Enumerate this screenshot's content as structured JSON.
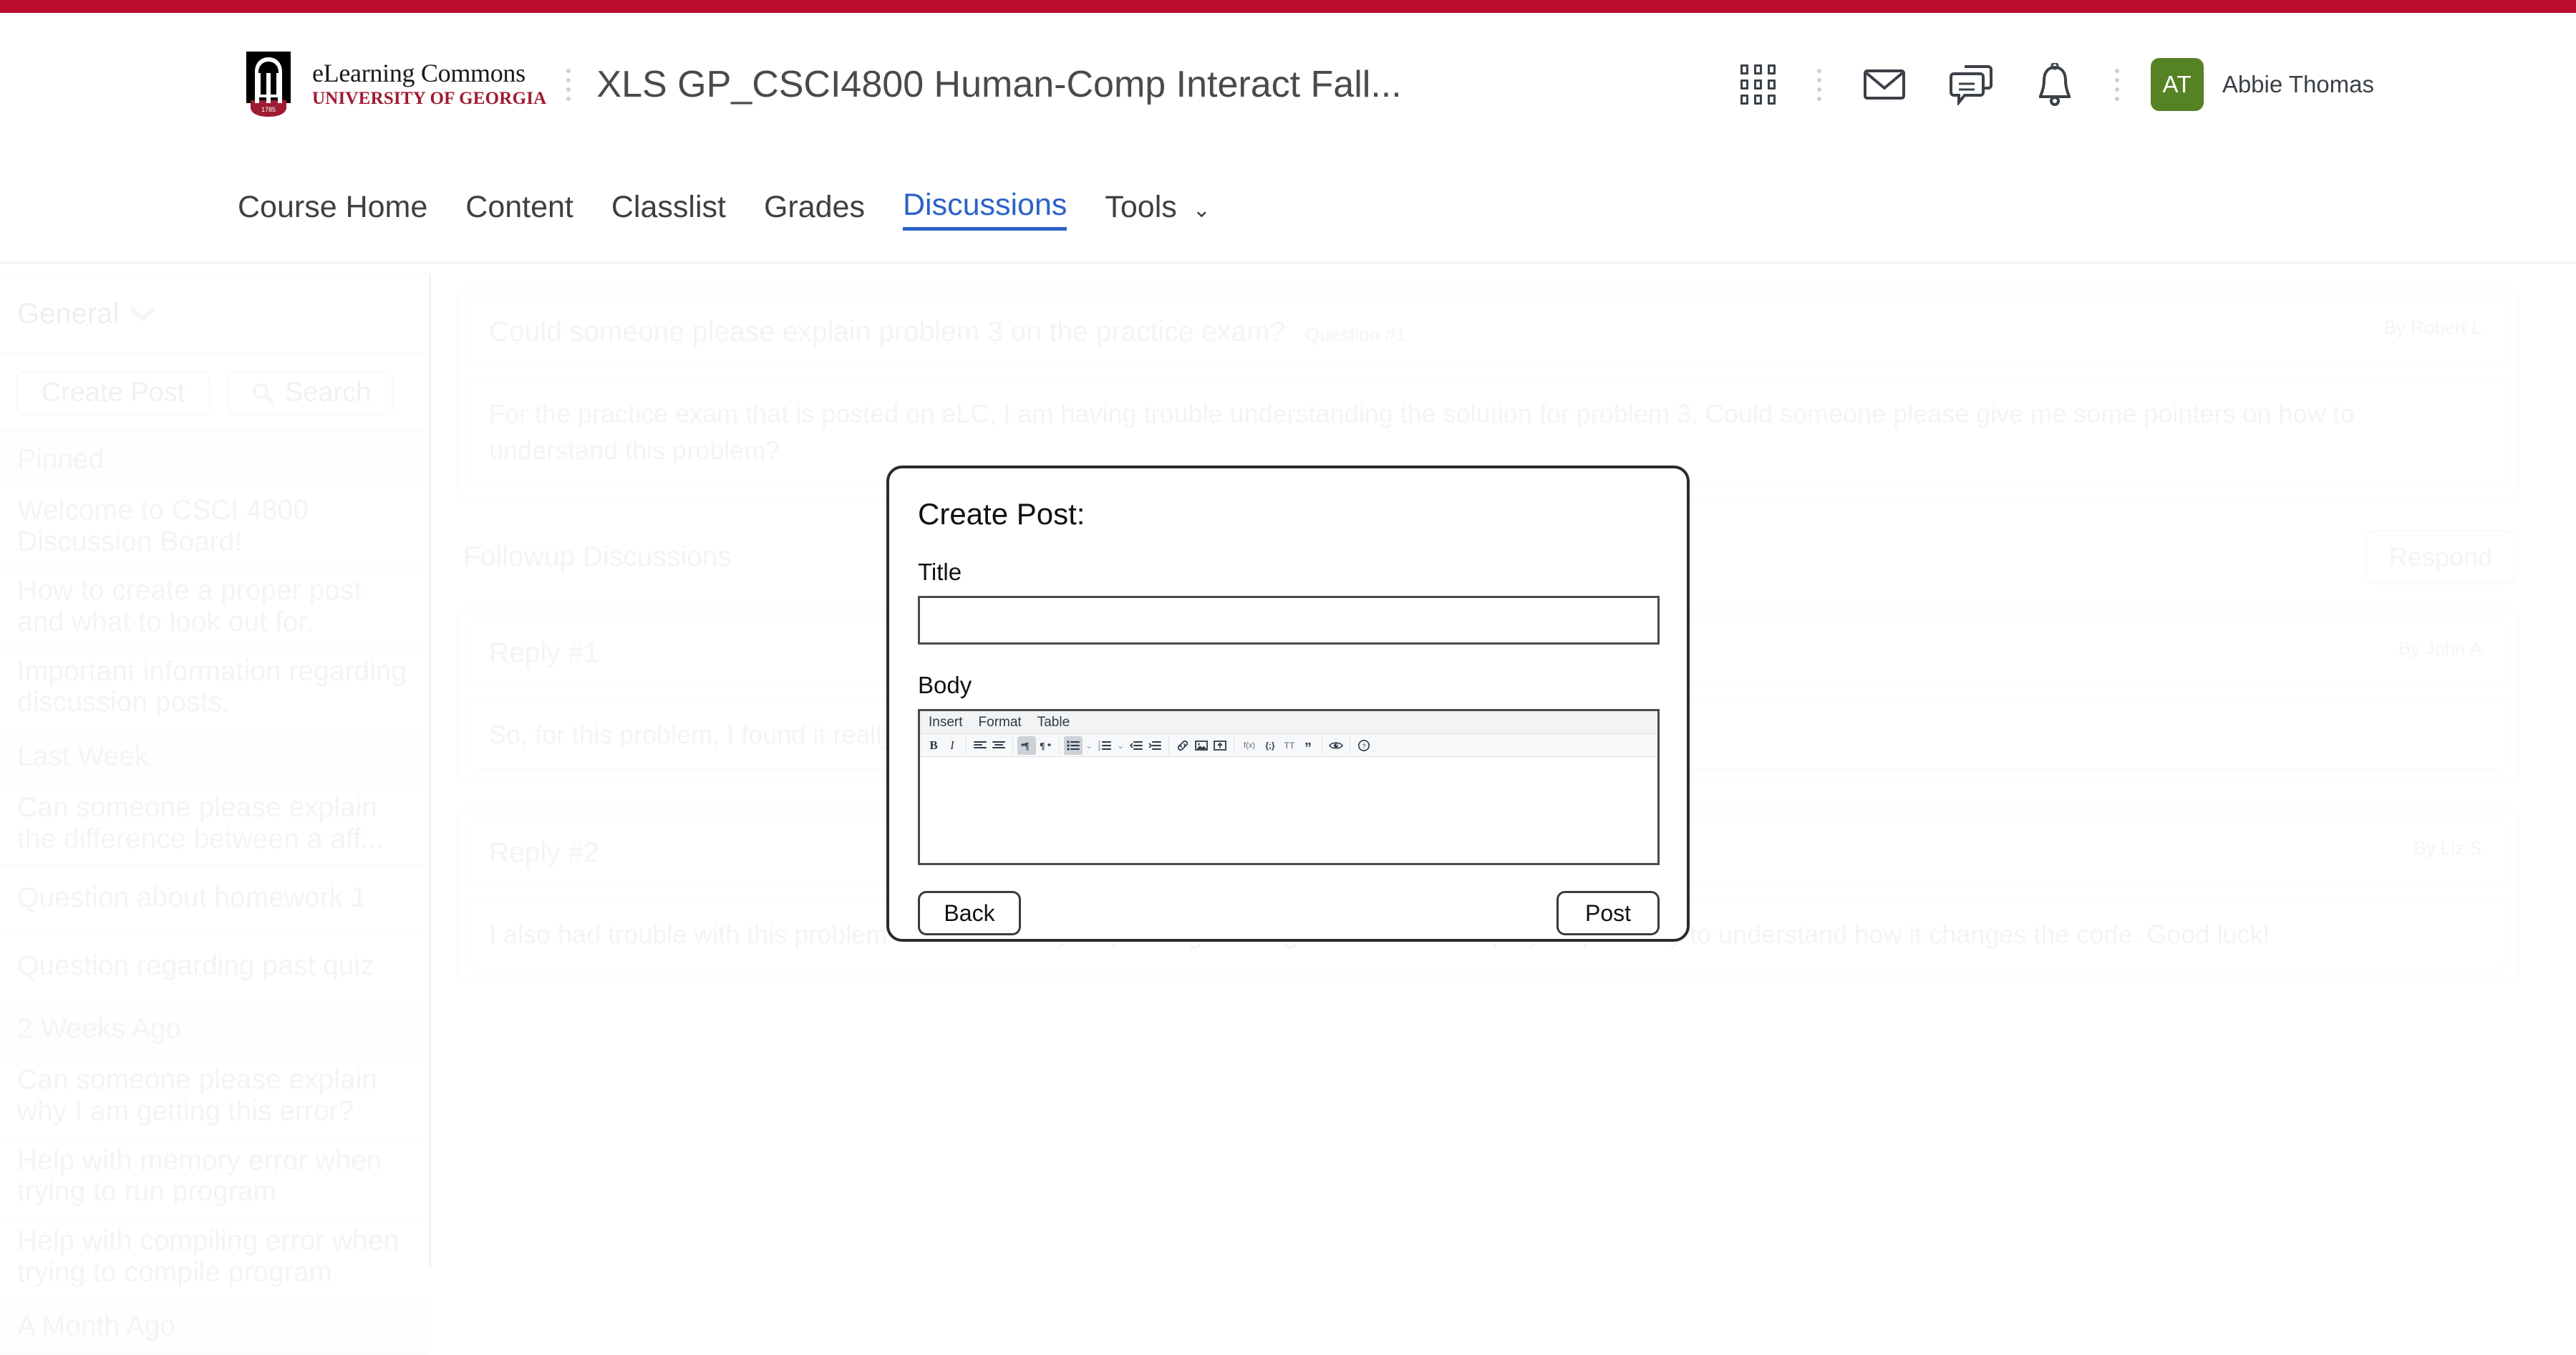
{
  "theme": {
    "crimson": "#BA0C2F",
    "brand_red": "#9E1B32",
    "avatar_green": "#558223",
    "active_blue": "#2B62C8"
  },
  "header": {
    "logo_line1": "eLearning Commons",
    "logo_line2": "UNIVERSITY OF GEORGIA",
    "logo_year": "1785",
    "course_title": "XLS GP_CSCI4800 Human-Comp Interact Fall...",
    "icons": [
      "waffle-icon",
      "email-icon",
      "chat-icon",
      "bell-icon"
    ],
    "avatar_initials": "AT",
    "user_name": "Abbie Thomas"
  },
  "nav": {
    "items": [
      {
        "label": "Course Home",
        "active": false,
        "caret": ""
      },
      {
        "label": "Content",
        "active": false,
        "caret": ""
      },
      {
        "label": "Classlist",
        "active": false,
        "caret": ""
      },
      {
        "label": "Grades",
        "active": false,
        "caret": ""
      },
      {
        "label": "Discussions",
        "active": true,
        "caret": ""
      },
      {
        "label": "Tools",
        "active": false,
        "caret": "⌄"
      }
    ]
  },
  "sidebar": {
    "forum_label": "General",
    "forum_caret": "❯",
    "create_post_label": "Create Post",
    "search_label": "Search",
    "search_icon": "search-icon",
    "groups": [
      {
        "label": "Pinned",
        "items": [
          "Welcome to CSCI 4800 Discussion Board!",
          "How to create a proper post and what to look out for.",
          "Important information regarding discussion posts."
        ]
      },
      {
        "label": "Last Week",
        "items": [
          "Can someone please explain the difference between a aff...",
          "Question about homework 1",
          "Question regarding past quiz"
        ]
      },
      {
        "label": "2 Weeks Ago",
        "items": [
          "Can someone please explain why I am getting this error?",
          "Help with memory error when trying to run program",
          "Help with compiling error when trying to compile program"
        ]
      },
      {
        "label": "A Month Ago",
        "items": []
      }
    ]
  },
  "thread": {
    "question": {
      "title": "Could someone please explain problem 3 on the practice exam?",
      "tag": "Question #1",
      "author": "By Robert L.",
      "body": "For the practice exam that is posted on eLC, I am having trouble understanding the solution for problem 3. Could someone please give me some pointers on how to understand this problem?"
    },
    "followup_label": "Followup Discussions",
    "respond_label": "Respond",
    "replies": [
      {
        "title": "Reply #1",
        "author": "By John A.",
        "body": "So, for this problem, I found it really helpful to look at this topic. Hope this helps!"
      },
      {
        "title": "Reply #2",
        "author": "By Liz S.",
        "body": "I also had trouble with this problem. I found it really helpful to go through the solution step by step and try to understand how it changes the code. Good luck!"
      }
    ]
  },
  "modal": {
    "heading": "Create Post:",
    "title_label": "Title",
    "title_value": "",
    "body_label": "Body",
    "editor": {
      "menus": [
        "Insert",
        "Format",
        "Table"
      ],
      "toolbar": [
        {
          "name": "bold-icon",
          "glyph": "B",
          "active": false
        },
        {
          "name": "italic-icon",
          "glyph": "I",
          "active": false
        },
        {
          "name": "sep",
          "glyph": "",
          "active": false
        },
        {
          "name": "align-left-icon",
          "glyph": "",
          "active": false
        },
        {
          "name": "align-center-icon",
          "glyph": "",
          "active": false
        },
        {
          "name": "sep",
          "glyph": "",
          "active": false
        },
        {
          "name": "ltr-icon",
          "glyph": "",
          "active": true
        },
        {
          "name": "rtl-icon",
          "glyph": "",
          "active": false
        },
        {
          "name": "sep",
          "glyph": "",
          "active": false
        },
        {
          "name": "bullet-list-icon",
          "glyph": "",
          "active": true
        },
        {
          "name": "bullet-list-chevron-icon",
          "glyph": "⌄",
          "active": false
        },
        {
          "name": "numbered-list-icon",
          "glyph": "",
          "active": false
        },
        {
          "name": "numbered-list-chevron-icon",
          "glyph": "⌄",
          "active": false
        },
        {
          "name": "outdent-icon",
          "glyph": "",
          "active": false
        },
        {
          "name": "indent-icon",
          "glyph": "",
          "active": false
        },
        {
          "name": "sep",
          "glyph": "",
          "active": false
        },
        {
          "name": "link-icon",
          "glyph": "",
          "active": false
        },
        {
          "name": "image-icon",
          "glyph": "",
          "active": false
        },
        {
          "name": "insert-stuff-icon",
          "glyph": "",
          "active": false
        },
        {
          "name": "sep",
          "glyph": "",
          "active": false
        },
        {
          "name": "equation-icon",
          "glyph": "f(x)",
          "active": false
        },
        {
          "name": "code-icon",
          "glyph": "{;}",
          "active": false
        },
        {
          "name": "text-style-icon",
          "glyph": "TT",
          "active": false
        },
        {
          "name": "quote-icon",
          "glyph": "”",
          "active": false
        },
        {
          "name": "sep",
          "glyph": "",
          "active": false
        },
        {
          "name": "preview-eye-icon",
          "glyph": "",
          "active": false
        },
        {
          "name": "sep",
          "glyph": "",
          "active": false
        },
        {
          "name": "help-icon",
          "glyph": "?",
          "active": false
        }
      ]
    },
    "body_value": "",
    "back_label": "Back",
    "post_label": "Post"
  }
}
